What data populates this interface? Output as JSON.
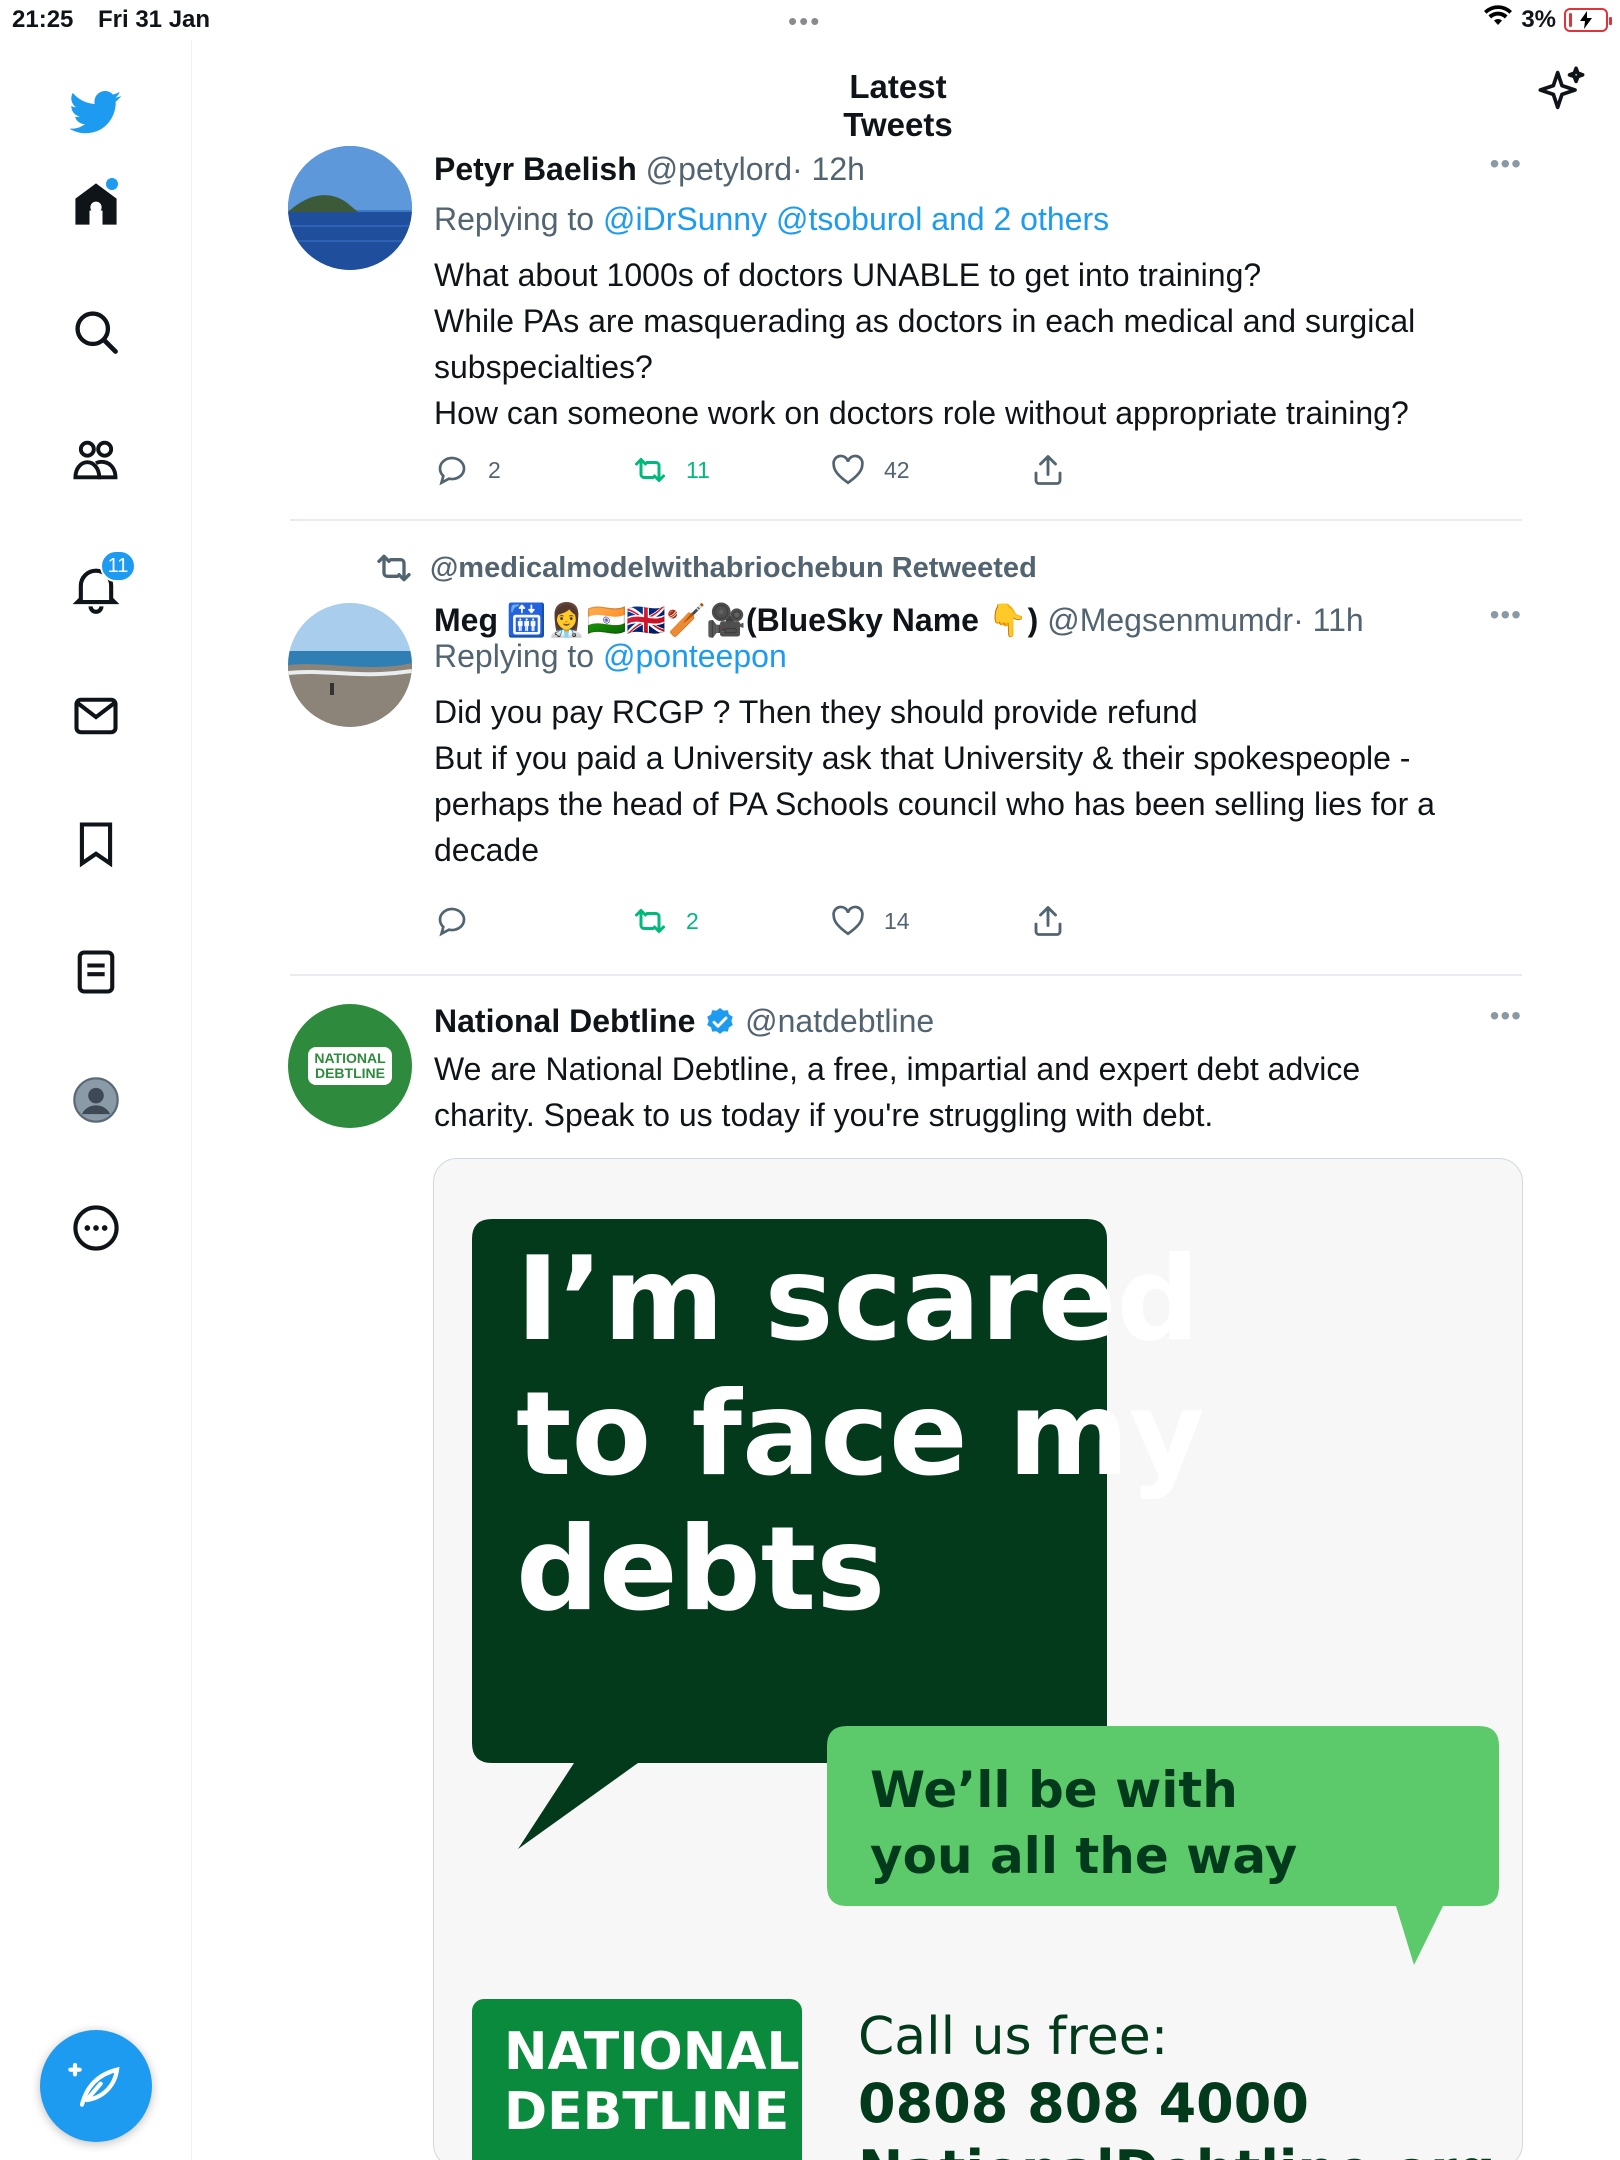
{
  "status_bar": {
    "time": "21:25",
    "date": "Fri 31 Jan",
    "center_dots": "•••",
    "battery_percent": "3%",
    "wifi_icon": "wifi-icon",
    "battery_icon": "battery-charging-icon"
  },
  "sidebar": {
    "logo_icon": "twitter-bird-icon",
    "items": [
      {
        "name": "home",
        "icon": "home-icon",
        "has_dot": true
      },
      {
        "name": "explore",
        "icon": "search-icon"
      },
      {
        "name": "communities",
        "icon": "communities-icon"
      },
      {
        "name": "notifications",
        "icon": "bell-icon",
        "badge": "11"
      },
      {
        "name": "messages",
        "icon": "mail-icon"
      },
      {
        "name": "bookmarks",
        "icon": "bookmark-icon"
      },
      {
        "name": "lists",
        "icon": "list-icon"
      },
      {
        "name": "profile",
        "icon": "profile-avatar-icon"
      },
      {
        "name": "more",
        "icon": "more-circle-icon"
      }
    ],
    "compose_icon": "compose-feather-icon"
  },
  "header": {
    "title": "Latest Tweets",
    "sparkle_icon": "sparkle-icon"
  },
  "tweets": [
    {
      "name": "Petyr Baelish",
      "handle": "@petylord",
      "time": "· 12h",
      "reply_prefix": "Replying to ",
      "reply_targets": "@iDrSunny @tsoburol and 2 others",
      "body": [
        "What about 1000s of doctors UNABLE to get into training?",
        "While PAs are masquerading as doctors in each medical and surgical",
        "subspecialties?",
        "How can someone work on doctors role without appropriate training?"
      ],
      "replies": "2",
      "retweets": "11",
      "likes": "42",
      "more": "•••"
    },
    {
      "retweeted_by": "@medicalmodelwithabriochebun Retweeted",
      "name": "Meg 🛗👩‍⚕️🇮🇳🇬🇧🏏🎥(BlueSky Name 👇)",
      "handle": "@Megsenmumdr",
      "time": "· 11h",
      "reply_prefix": "Replying to ",
      "reply_targets": "@ponteepon",
      "body": [
        "Did you pay RCGP ? Then they should provide refund",
        "But if you paid a University ask that University & their spokespeople -",
        "perhaps the head of PA Schools council who has been selling lies for a",
        "decade"
      ],
      "replies": "",
      "retweets": "2",
      "likes": "14",
      "more": "•••"
    },
    {
      "name": "National Debtline",
      "handle": "@natdebtline",
      "verified": true,
      "avatar_text": [
        "NATIONAL",
        "DEBTLINE"
      ],
      "body": [
        "We are National Debtline, a free, impartial and expert debt advice",
        "charity. Speak to us today if you're struggling with debt."
      ],
      "more": "•••",
      "ad": {
        "bubble_lines": [
          "I’m scared",
          "to face my",
          "debts"
        ],
        "reply_lines": [
          "We’ll be with",
          "you all the way"
        ],
        "logo_lines": [
          "NATIONAL",
          "DEBTLINE"
        ],
        "call_label": "Call us free:",
        "phone": "0808 808 4000",
        "website": "NationalDebtline.org",
        "colors": {
          "dark_green": "#033a1c",
          "light_green": "#5cc96a",
          "logo_green": "#0a8a3c"
        }
      }
    }
  ],
  "colors": {
    "brand_blue": "#1d9bf0",
    "retweet_green": "#00ba7c",
    "secondary_text": "#536471",
    "battery_red": "#e0333a"
  }
}
